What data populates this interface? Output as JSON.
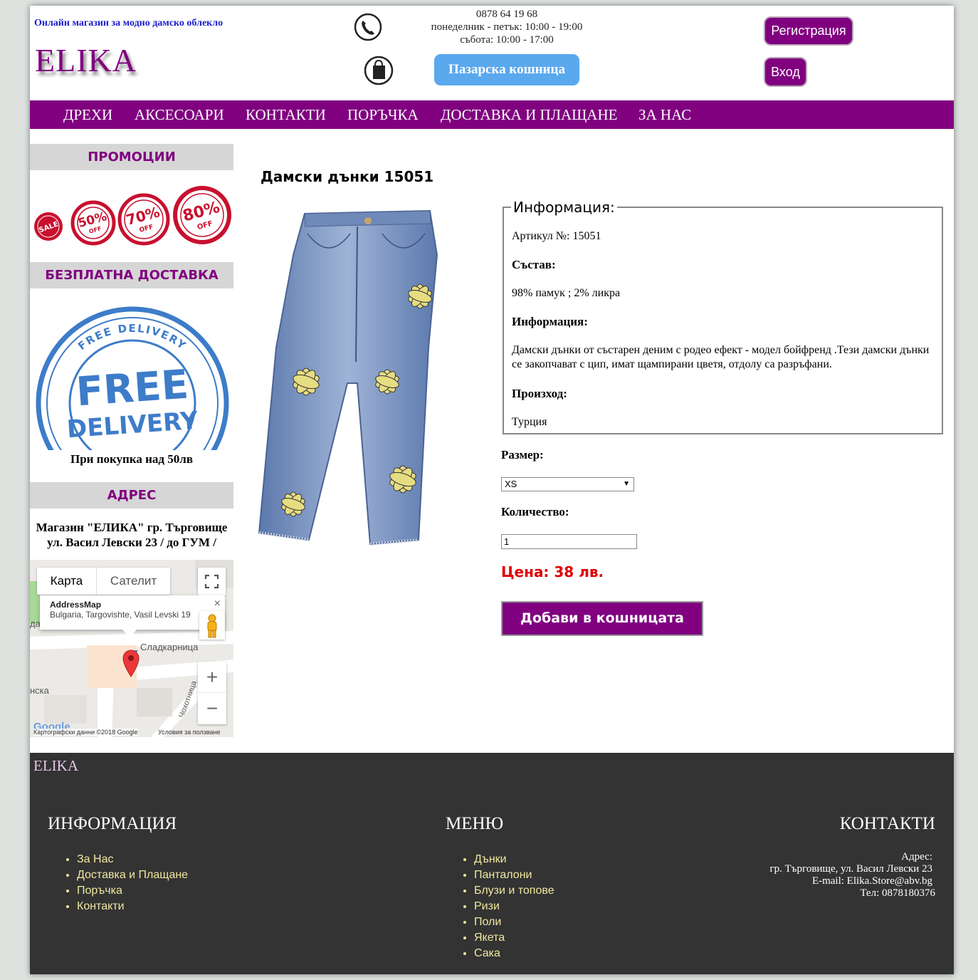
{
  "header": {
    "tagline": "Онлайн магазин за модно дамско облекло",
    "logo": "ELIKA",
    "phone": "0878 64 19 68",
    "hours_weekdays": "понеделник - петък: 10:00 - 19:00",
    "hours_saturday": "събота: 10:00 - 17:00",
    "cart_label": "Пазарска кошница",
    "register_label": "Регистрация",
    "login_label": "Вход"
  },
  "nav": {
    "items": [
      {
        "label": "ДРЕХИ"
      },
      {
        "label": "АКСЕСОАРИ"
      },
      {
        "label": "КОНТАКТИ"
      },
      {
        "label": "ПОРЪЧКА"
      },
      {
        "label": "ДОСТАВКА И ПЛАЩАНЕ"
      },
      {
        "label": "ЗА НАС"
      }
    ]
  },
  "sidebar": {
    "promotions_title": "ПРОМОЦИИ",
    "promo_badges": [
      "SALE",
      "50%",
      "OFF",
      "70%",
      "OFF",
      "80%",
      "OFF"
    ],
    "free_delivery_title": "БЕЗПЛАТНА ДОСТАВКА",
    "stamp_main": "FREE",
    "stamp_sub": "DELIVERY",
    "stamp_ring": "FREE DELIVERY",
    "free_delivery_caption": "При покупка над 50лв",
    "address_title": "АДРЕС",
    "address_line1": "Магазин \"ЕЛИКА\" гр. Търговище",
    "address_line2": "ул. Васил Левски 23 / до ГУМ /"
  },
  "map": {
    "tab_map": "Карта",
    "tab_satellite": "Сателит",
    "info_title": "AddressMap",
    "info_address": "Bulgaria, Targovishte, Vasil Levski 19",
    "close_symbol": "×",
    "label_shop": "Сладкарница",
    "label_street": "Чохотница",
    "label_left1": "да",
    "label_left2": "нска",
    "zoom_in": "+",
    "zoom_out": "−",
    "google": "Google",
    "attribution": "Картографски данни ©2018 Google",
    "terms": "Условия за ползване"
  },
  "product": {
    "title": "Дамски дънки 15051",
    "info_legend": "Информация:",
    "article": "Артикул №: 15051",
    "composition_label": "Състав:",
    "composition": "98% памук ; 2% ликра",
    "info_label": "Информация:",
    "info_text": "Дамски дънки от състарен деним с родео ефект - модел бойфренд .Тези дамски дънки се закопчават с цип, имат щампирани цветя, отдолу са разръфани.",
    "origin_label": "Произход:",
    "origin": "Турция",
    "size_label": "Размер:",
    "size_value": "XS",
    "quantity_label": "Количество:",
    "quantity_value": "1",
    "price": "Цена: 38 лв.",
    "add_to_cart_label": "Добави в кошницата"
  },
  "footer": {
    "logo": "ELIKA",
    "info_title": "ИНФОРМАЦИЯ",
    "info_links": [
      "За Нас",
      "Доставка и Плащане",
      "Поръчка",
      "Контакти"
    ],
    "menu_title": "МЕНЮ",
    "menu_links": [
      "Дънки",
      "Панталони",
      "Блузи и топове",
      "Ризи",
      "Поли",
      "Якета",
      "Сака"
    ],
    "contacts_title": "КОНТАКТИ",
    "contact_address_label": "Адрес:",
    "contact_address": "гр. Търговище, ул. Васил Левски 23",
    "contact_email": "E-mail: Elika.Store@abv.bg",
    "contact_phone": "Тел: 0878180376"
  },
  "colors": {
    "brand_purple": "#800080",
    "cart_blue": "#5aa8ee",
    "price_red": "#e00000",
    "footer_bg": "#333333",
    "footer_link": "#f0e8a0"
  }
}
